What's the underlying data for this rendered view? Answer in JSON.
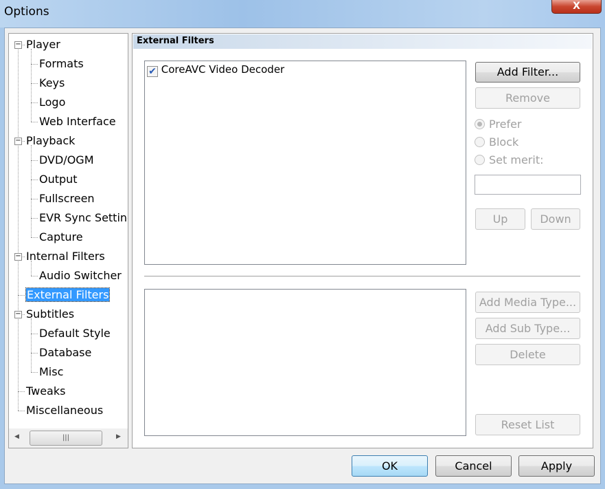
{
  "window": {
    "title": "Options",
    "close_glyph": "X"
  },
  "tree": [
    {
      "label": "Player",
      "level": 0,
      "expander": "minus"
    },
    {
      "label": "Formats",
      "level": 1
    },
    {
      "label": "Keys",
      "level": 1
    },
    {
      "label": "Logo",
      "level": 1
    },
    {
      "label": "Web Interface",
      "level": 1
    },
    {
      "label": "Playback",
      "level": 0,
      "expander": "minus"
    },
    {
      "label": "DVD/OGM",
      "level": 1
    },
    {
      "label": "Output",
      "level": 1
    },
    {
      "label": "Fullscreen",
      "level": 1
    },
    {
      "label": "EVR Sync Settings",
      "level": 1
    },
    {
      "label": "Capture",
      "level": 1
    },
    {
      "label": "Internal Filters",
      "level": 0,
      "expander": "minus"
    },
    {
      "label": "Audio Switcher",
      "level": 1
    },
    {
      "label": "External Filters",
      "level": 0,
      "selected": true
    },
    {
      "label": "Subtitles",
      "level": 0,
      "expander": "minus"
    },
    {
      "label": "Default Style",
      "level": 1
    },
    {
      "label": "Database",
      "level": 1
    },
    {
      "label": "Misc",
      "level": 1
    },
    {
      "label": "Tweaks",
      "level": 0
    },
    {
      "label": "Miscellaneous",
      "level": 0
    }
  ],
  "section": {
    "title": "External Filters"
  },
  "filters": [
    {
      "label": "CoreAVC Video Decoder",
      "checked": true
    }
  ],
  "buttons": {
    "add_filter": "Add Filter...",
    "remove": "Remove",
    "up": "Up",
    "down": "Down",
    "add_media_type": "Add Media Type...",
    "add_sub_type": "Add Sub Type...",
    "delete": "Delete",
    "reset_list": "Reset List",
    "ok": "OK",
    "cancel": "Cancel",
    "apply": "Apply"
  },
  "radios": [
    {
      "label": "Prefer",
      "selected": true
    },
    {
      "label": "Block",
      "selected": false
    },
    {
      "label": "Set merit:",
      "selected": false
    }
  ],
  "merit_value": "",
  "colors": {
    "selection": "#3399ff",
    "title_bar": "#9dc1e8"
  }
}
